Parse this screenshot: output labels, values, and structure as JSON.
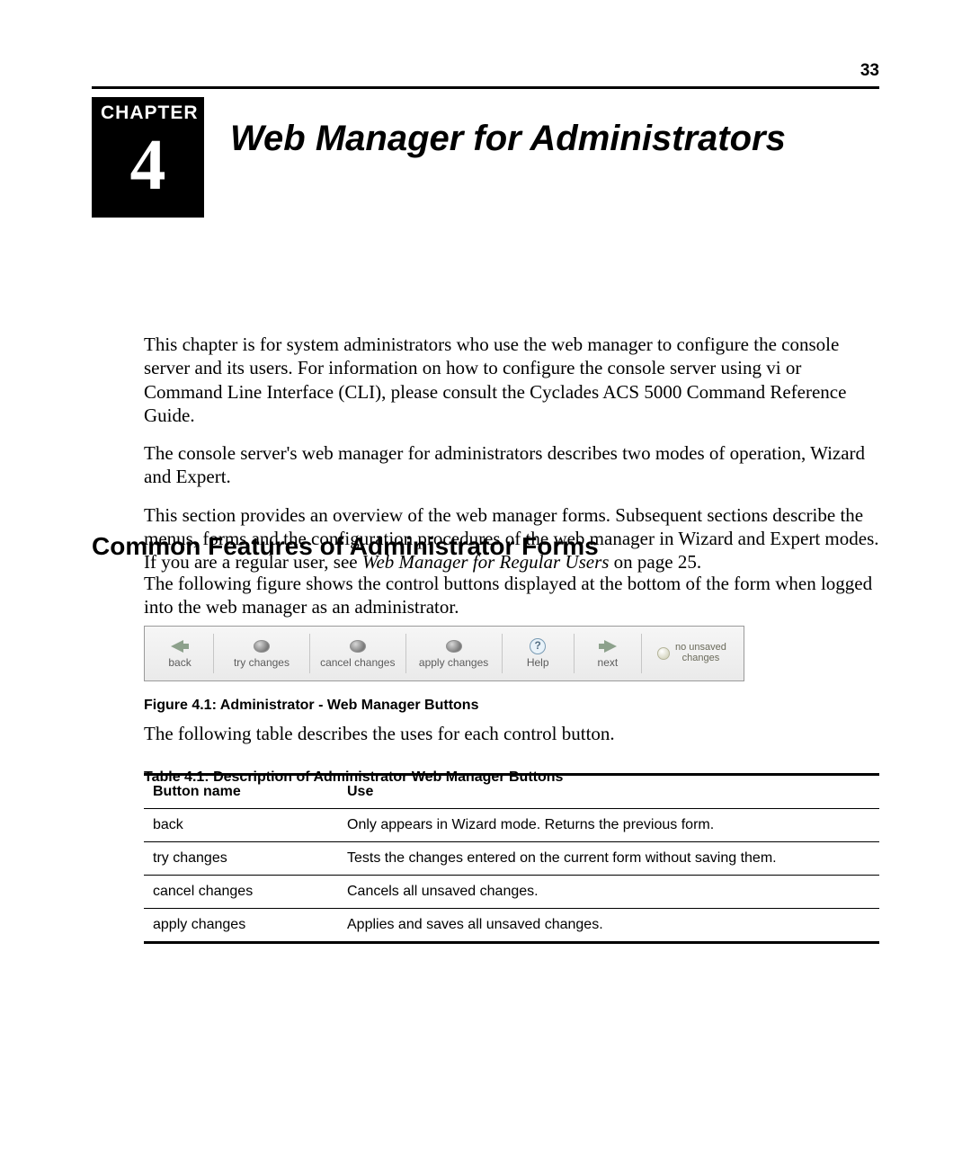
{
  "page_number": "33",
  "chapter": {
    "label": "CHAPTER",
    "number": "4",
    "title": "Web Manager for Administrators"
  },
  "intro": {
    "p1": "This chapter is for system administrators who use the web manager to configure the console server and its users. For information on how to configure the console server using vi or Command Line Interface (CLI), please consult the Cyclades ACS 5000 Command Reference Guide.",
    "p2": "The console server's web manager for administrators describes two modes of operation, Wizard and Expert.",
    "p3_a": "This section provides an overview of the web manager forms. Subsequent sections describe the menus, forms and the configuration procedures of the web manager in Wizard and Expert modes. If you are a regular user, see ",
    "p3_ref": "Web Manager for Regular Users",
    "p3_b": " on page 25."
  },
  "section_heading": "Common Features of Administrator Forms",
  "section_intro": "The following figure shows the control buttons displayed at the bottom of the form when logged into the web manager as an administrator.",
  "figure": {
    "buttons": {
      "back": "back",
      "try": "try changes",
      "cancel": "cancel changes",
      "apply": "apply changes",
      "help": "Help",
      "next": "next",
      "unsaved_line1": "no unsaved",
      "unsaved_line2": "changes"
    },
    "caption": "Figure 4.1: Administrator - Web Manager Buttons"
  },
  "after_figure": "The following table describes the uses for each control button.",
  "table": {
    "caption": "Table 4.1: Description of Administrator Web Manager Buttons",
    "headers": {
      "name": "Button name",
      "use": "Use"
    },
    "rows": [
      {
        "name": "back",
        "use": "Only appears in Wizard mode. Returns the previous form."
      },
      {
        "name": "try changes",
        "use": "Tests the changes entered on the current form without saving them."
      },
      {
        "name": "cancel changes",
        "use": "Cancels all unsaved changes."
      },
      {
        "name": "apply changes",
        "use": "Applies and saves all unsaved changes."
      }
    ]
  }
}
